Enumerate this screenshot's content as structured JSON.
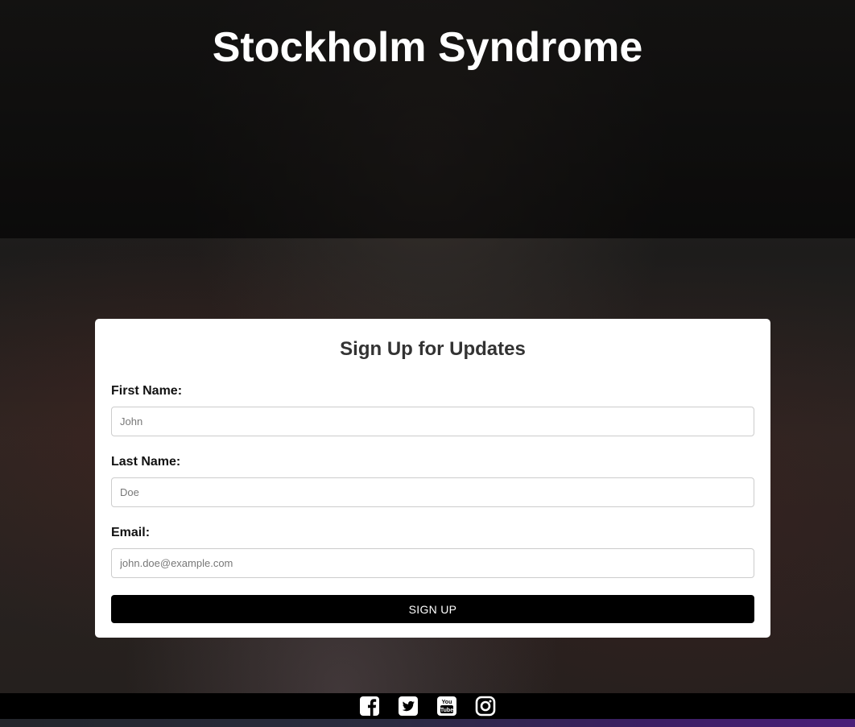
{
  "header": {
    "title": "Stockholm Syndrome"
  },
  "form": {
    "title": "Sign Up for Updates",
    "fields": [
      {
        "label": "First Name:",
        "placeholder": "John",
        "value": ""
      },
      {
        "label": "Last Name:",
        "placeholder": "Doe",
        "value": ""
      },
      {
        "label": "Email:",
        "placeholder": "john.doe@example.com",
        "value": ""
      }
    ],
    "submit_label": "SIGN UP"
  },
  "footer": {
    "social_icons": [
      "facebook-icon",
      "twitter-icon",
      "youtube-icon",
      "instagram-icon"
    ]
  },
  "colors": {
    "button_bg": "#000000",
    "footer_bg": "#000000",
    "card_bg": "#ffffff",
    "title_text": "#ffffff"
  }
}
